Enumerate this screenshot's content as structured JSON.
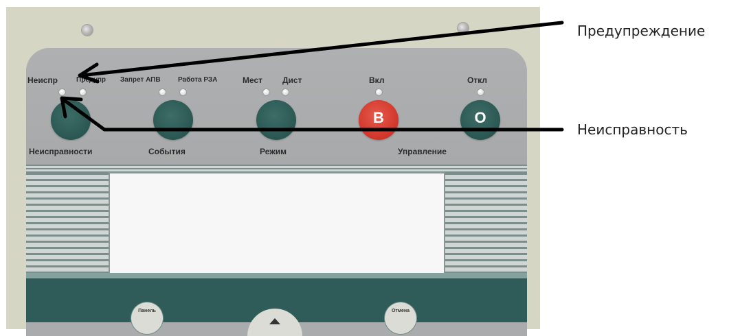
{
  "indicators": {
    "neispr": "Неиспр",
    "preduppr": "Предупр",
    "zapret_apv": "Запрет АПВ",
    "rabota_rza": "Работа РЗА",
    "mest": "Мест",
    "dist": "Дист",
    "vkl": "Вкл",
    "otkl": "Откл"
  },
  "buttons": {
    "faults_label": "Неисправности",
    "events_label": "События",
    "mode_label": "Режим",
    "control_label": "Управление",
    "on_letter": "В",
    "off_letter": "О"
  },
  "lower_keys": {
    "panel_label": "Панель",
    "cancel_label": "Отмена"
  },
  "callouts": {
    "warning": "Предупреждение",
    "fault": "Неисправность"
  },
  "colors": {
    "panel_grey": "#a9abac",
    "button_teal": "#2d5a55",
    "button_red": "#d43a2e"
  }
}
